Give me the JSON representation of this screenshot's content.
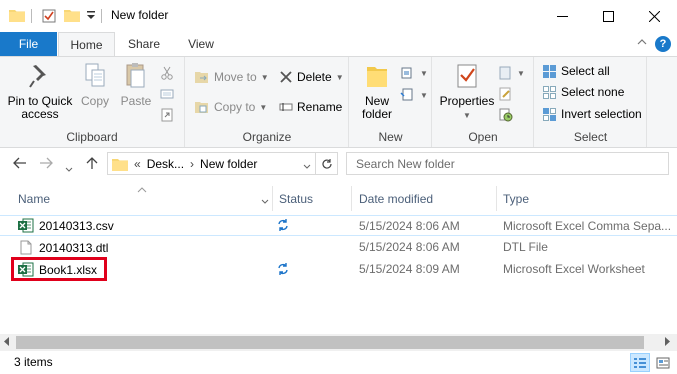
{
  "window": {
    "title": "New folder",
    "minimize": "—",
    "maximize": "☐",
    "close": "✕"
  },
  "tabs": [
    {
      "label": "File"
    },
    {
      "label": "Home"
    },
    {
      "label": "Share"
    },
    {
      "label": "View"
    }
  ],
  "ribbon": {
    "clipboard": {
      "label": "Clipboard",
      "pin_to_quick_access": "Pin to Quick access",
      "pin_line1": "Pin to Quick",
      "pin_line2": "access",
      "copy": "Copy",
      "paste": "Paste"
    },
    "organize": {
      "label": "Organize",
      "move_to": "Move to",
      "copy_to": "Copy to",
      "delete": "Delete",
      "rename": "Rename"
    },
    "new": {
      "label": "New",
      "new_folder_line1": "New",
      "new_folder_line2": "folder"
    },
    "open": {
      "label": "Open",
      "properties": "Properties"
    },
    "select": {
      "label": "Select",
      "select_all": "Select all",
      "select_none": "Select none",
      "invert_selection": "Invert selection"
    }
  },
  "address": {
    "overflow": "«",
    "crumb1": "Desk...",
    "separator": "›",
    "crumb2": "New folder"
  },
  "search": {
    "placeholder": "Search New folder"
  },
  "columns": {
    "name": "Name",
    "status": "Status",
    "date_modified": "Date modified",
    "type": "Type"
  },
  "files": [
    {
      "name": "20140313.csv",
      "date": "5/15/2024 8:06 AM",
      "type": "Microsoft Excel Comma Sepa...",
      "icon": "excel-icon"
    },
    {
      "name": "20140313.dtl",
      "date": "5/15/2024 8:06 AM",
      "type": "DTL File",
      "icon": "blank-file-icon"
    },
    {
      "name": "Book1.xlsx",
      "date": "5/15/2024 8:09 AM",
      "type": "Microsoft Excel Worksheet",
      "icon": "excel-icon"
    }
  ],
  "status_bar": {
    "item_count": "3 items"
  },
  "colors": {
    "file_tab": "#1979ca",
    "highlight": "#e0001b",
    "sync_blue": "#1a73c9",
    "excel_green": "#1d7044"
  }
}
